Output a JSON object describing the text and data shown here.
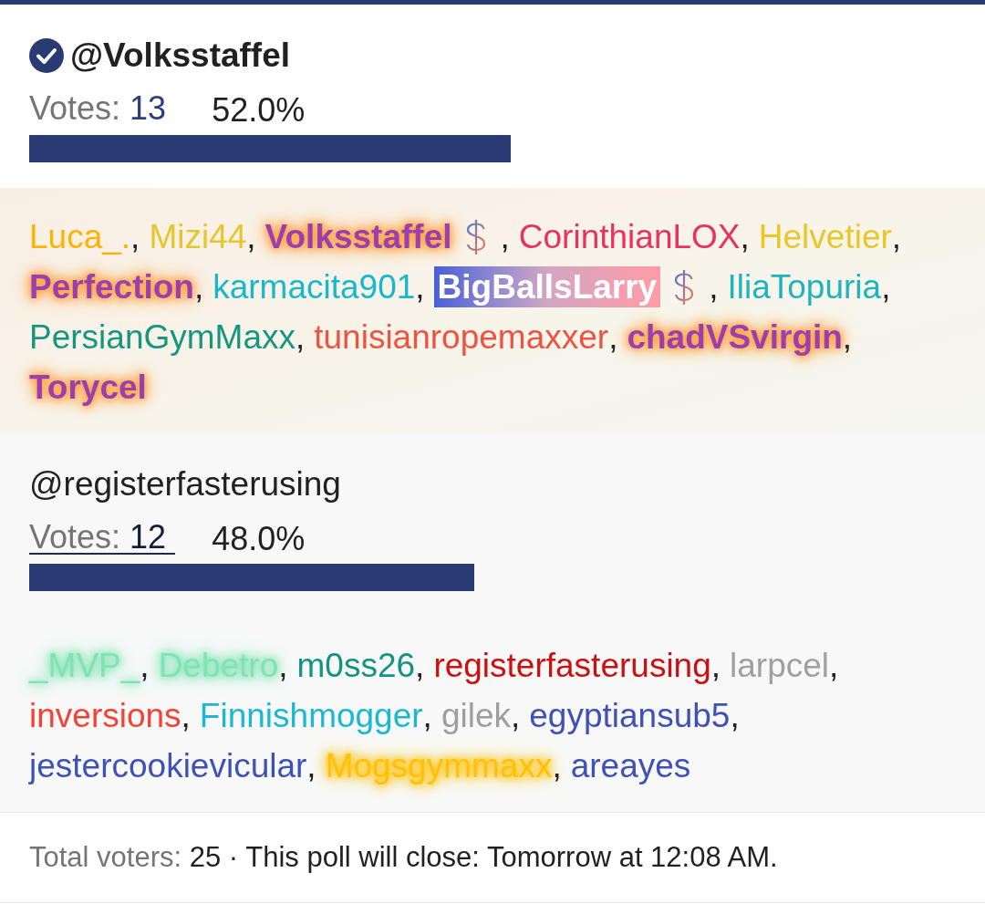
{
  "poll": {
    "options": [
      {
        "title": "@Volksstaffel",
        "voted": true,
        "votes_label": "Votes:",
        "votes": "13",
        "underlined": false,
        "percent": "52.0%",
        "level": 0.52,
        "voters": [
          {
            "name": "Luca_.",
            "kind": "plain",
            "color": "#ffb300",
            "supporter": false,
            "separator": ","
          },
          {
            "name": "Mizi44",
            "kind": "plain",
            "color": "#e6c62e",
            "supporter": false,
            "separator": ","
          },
          {
            "name": "Volksstaffel",
            "kind": "aura",
            "color": "#9a3fae",
            "supporter": true,
            "separator": ","
          },
          {
            "name": "CorinthianLOX",
            "kind": "plain",
            "color": "#e8325f",
            "supporter": false,
            "separator": ","
          },
          {
            "name": "Helvetier",
            "kind": "plain",
            "color": "#e6c828",
            "supporter": false,
            "separator": ","
          },
          {
            "name": "Perfection",
            "kind": "aura",
            "color": "#9a3fae",
            "supporter": false,
            "separator": ","
          },
          {
            "name": "karmacita901",
            "kind": "plain",
            "color": "#17b8cc",
            "supporter": false,
            "separator": ","
          },
          {
            "name": "BigBallsLarry",
            "kind": "banner",
            "supporter": true,
            "separator": ","
          },
          {
            "name": "IliaTopuria",
            "kind": "plain",
            "color": "#1fb4bd",
            "supporter": false,
            "separator": ","
          },
          {
            "name": "PersianGymMaxx",
            "kind": "plain",
            "color": "#16967f",
            "supporter": false,
            "separator": ","
          },
          {
            "name": "tunisianropemaxxer",
            "kind": "plain",
            "color": "#ee5340",
            "supporter": false,
            "separator": ","
          },
          {
            "name": "chadVSvirgin",
            "kind": "aura",
            "color": "#9a3fae",
            "supporter": false,
            "separator": ","
          },
          {
            "name": "Torycel",
            "kind": "aura",
            "color": "#9a3fae",
            "supporter": false
          }
        ]
      },
      {
        "title": "@registerfasterusing",
        "voted": false,
        "votes_label": "Votes:",
        "votes": "12",
        "underlined": true,
        "percent": "48.0%",
        "level": 0.48,
        "voters": [
          {
            "name": "_MVP_",
            "kind": "glow",
            "color": "#7fe3b2",
            "supporter": false,
            "separator": ","
          },
          {
            "name": "Debetro",
            "kind": "glow",
            "color": "#7fe3b2",
            "supporter": false,
            "separator": ","
          },
          {
            "name": "m0ss26",
            "kind": "plain",
            "color": "#119480",
            "supporter": false,
            "separator": ","
          },
          {
            "name": "registerfasterusing",
            "kind": "plain",
            "color": "#cc0f0f",
            "supporter": false,
            "separator": ","
          },
          {
            "name": "larpcel",
            "kind": "plain",
            "color": "#a0a0a0",
            "supporter": false,
            "separator": ","
          },
          {
            "name": "inversions",
            "kind": "plain",
            "color": "#f44336",
            "supporter": false,
            "separator": ","
          },
          {
            "name": "Finnishmogger",
            "kind": "plain",
            "color": "#1cb8d2",
            "supporter": false,
            "separator": ","
          },
          {
            "name": "gilek",
            "kind": "plain",
            "color": "#9e9e9e",
            "supporter": false,
            "separator": ","
          },
          {
            "name": "egyptiansub5",
            "kind": "plain",
            "color": "#3f51b5",
            "supporter": false,
            "separator": ","
          },
          {
            "name": "jestercookievicular",
            "kind": "plain",
            "color": "#3f51b5",
            "supporter": false,
            "separator": ","
          },
          {
            "name": "Mogsgymmaxx",
            "kind": "glow",
            "color": "#ffc107",
            "supporter": false,
            "separator": ","
          },
          {
            "name": "areayes",
            "kind": "plain",
            "color": "#3f51b5",
            "supporter": false
          }
        ]
      }
    ]
  },
  "footer": {
    "label": "Total voters:",
    "text": "25 · This poll will close: Tomorrow at 12:08 AM."
  }
}
